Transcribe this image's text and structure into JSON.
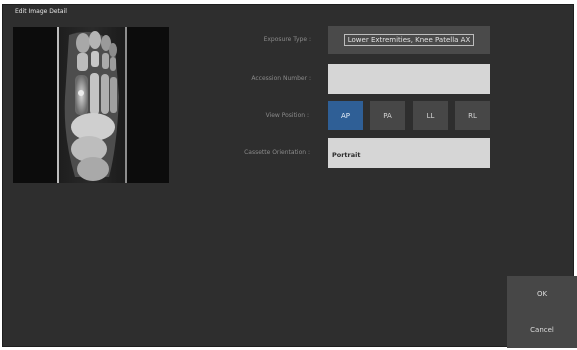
{
  "dialog": {
    "title": "Edit Image Detail"
  },
  "form": {
    "exposure_type": {
      "label": "Exposure Type :",
      "value": "Lower Extremities, Knee Patella AX"
    },
    "accession_number": {
      "label": "Accession Number :",
      "value": ""
    },
    "view_position": {
      "label": "View Position :",
      "options": [
        "AP",
        "PA",
        "LL",
        "RL"
      ],
      "selected": "AP"
    },
    "cassette_orientation": {
      "label": "Cassette Orientation :",
      "value": "Portrait"
    }
  },
  "actions": {
    "ok_label": "OK",
    "cancel_label": "Cancel"
  },
  "colors": {
    "dialog_background": "#2e2e2e",
    "selected_option": "#2f5f96",
    "button_background": "#474747",
    "input_background": "#d6d6d6"
  },
  "preview": {
    "icon": "foot-xray-image"
  }
}
